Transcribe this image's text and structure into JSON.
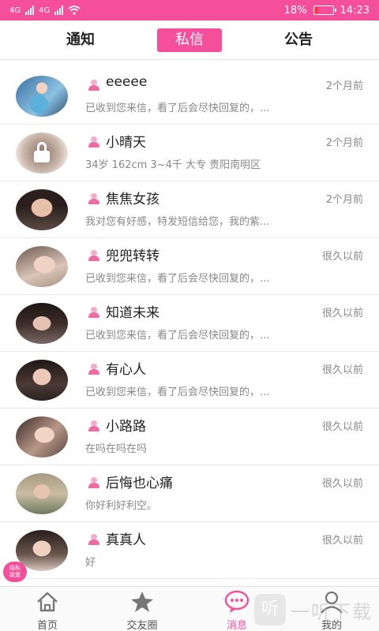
{
  "status_bar": {
    "signal_1": "4G",
    "signal_2": "4G",
    "battery_percent": "18%",
    "time": "14:23",
    "battery_level": 0.18,
    "color": "#f54f9c"
  },
  "tabs": [
    {
      "label": "通知",
      "active": false
    },
    {
      "label": "私信",
      "active": true
    },
    {
      "label": "公告",
      "active": false
    }
  ],
  "messages": [
    {
      "name": "eeeee",
      "time": "2个月前",
      "preview": "已收到您来信，看了后会尽快回复的，...",
      "avatar": "photo",
      "locked": false
    },
    {
      "name": "小晴天",
      "time": "2个月前",
      "preview": "34岁 162cm 3~4千 大专 贵阳南明区",
      "avatar": "locked",
      "locked": true
    },
    {
      "name": "焦焦女孩",
      "time": "2个月前",
      "preview": "我对您有好感，特发短信给您，我的紫...",
      "avatar": "photo",
      "locked": false
    },
    {
      "name": "兜兜转转",
      "time": "很久以前",
      "preview": "已收到您来信，看了后会尽快回复的，...",
      "avatar": "photo",
      "locked": false
    },
    {
      "name": "知道未来",
      "time": "很久以前",
      "preview": "已收到您来信，看了后会尽快回复的，...",
      "avatar": "photo",
      "locked": false
    },
    {
      "name": "有心人",
      "time": "很久以前",
      "preview": "已收到您来信，看了后会尽快回复的，...",
      "avatar": "photo",
      "locked": false
    },
    {
      "name": "小路路",
      "time": "很久以前",
      "preview": "在吗在吗在吗",
      "avatar": "photo",
      "locked": false
    },
    {
      "name": "后悔也心痛",
      "time": "很久以前",
      "preview": "你好利好利空。",
      "avatar": "photo",
      "locked": false
    },
    {
      "name": "真真人",
      "time": "很久以前",
      "preview": "好",
      "avatar": "photo",
      "locked": false
    }
  ],
  "privacy_badge": {
    "line1": "隐私",
    "line2": "政策"
  },
  "bottom_nav": [
    {
      "label": "首页",
      "icon": "home-icon",
      "active": false
    },
    {
      "label": "交友圈",
      "icon": "star-icon",
      "active": false
    },
    {
      "label": "消息",
      "icon": "chat-icon",
      "active": true
    },
    {
      "label": "我的",
      "icon": "profile-icon",
      "active": false
    }
  ],
  "watermark": {
    "glyph": "听",
    "text": "一听下载"
  },
  "accent_color": "#f54f9c"
}
